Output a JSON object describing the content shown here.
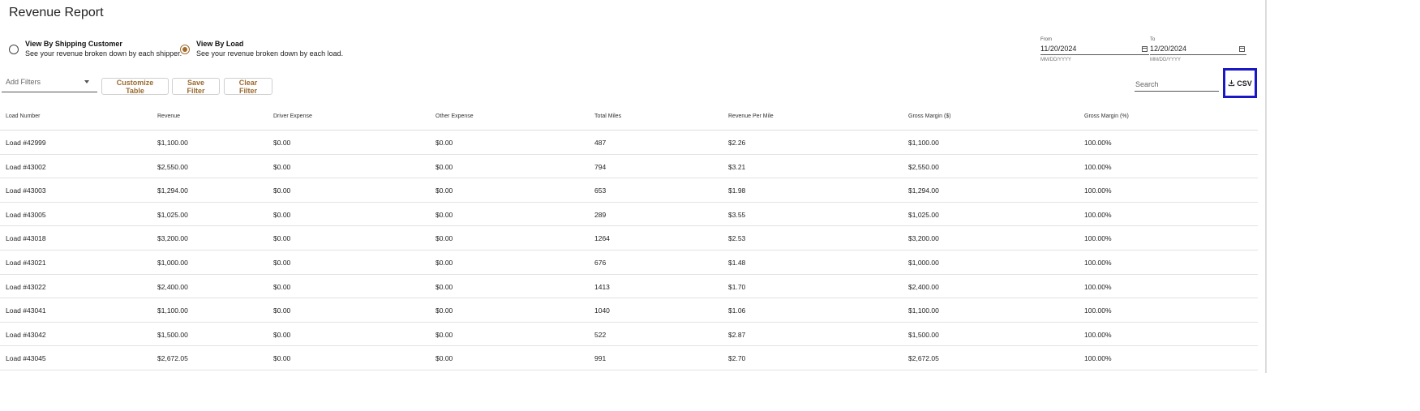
{
  "page": {
    "title": "Revenue Report"
  },
  "view_options": [
    {
      "label": "View By Shipping Customer",
      "description": "See your revenue broken down by each shipper.",
      "selected": false
    },
    {
      "label": "View By Load",
      "description": "See your revenue broken down by each load.",
      "selected": true
    }
  ],
  "date_from": {
    "label": "From",
    "value": "11/20/2024",
    "hint": "MM/DD/YYYY",
    "icon": "calendar-icon"
  },
  "date_to": {
    "label": "To",
    "value": "12/20/2024",
    "hint": "MM/DD/YYYY",
    "icon": "calendar-icon"
  },
  "filters": {
    "add_filters_placeholder": "Add Filters",
    "customize_table": "Customize Table",
    "save_filter": "Save Filter",
    "clear_filter": "Clear Filter",
    "search_placeholder": "Search",
    "csv_label": "CSV",
    "csv_icon": "download-icon"
  },
  "colors": {
    "accent": "#a36b2a",
    "button_text": "#9a6a2f",
    "highlight_border": "#1a17c4"
  },
  "table": {
    "columns": [
      "Load Number",
      "Revenue",
      "Driver Expense",
      "Other Expense",
      "Total Miles",
      "Revenue Per Mile",
      "Gross Margin ($)",
      "Gross Margin (%)"
    ],
    "rows": [
      [
        "Load #42999",
        "$1,100.00",
        "$0.00",
        "$0.00",
        "487",
        "$2.26",
        "$1,100.00",
        "100.00%"
      ],
      [
        "Load #43002",
        "$2,550.00",
        "$0.00",
        "$0.00",
        "794",
        "$3.21",
        "$2,550.00",
        "100.00%"
      ],
      [
        "Load #43003",
        "$1,294.00",
        "$0.00",
        "$0.00",
        "653",
        "$1.98",
        "$1,294.00",
        "100.00%"
      ],
      [
        "Load #43005",
        "$1,025.00",
        "$0.00",
        "$0.00",
        "289",
        "$3.55",
        "$1,025.00",
        "100.00%"
      ],
      [
        "Load #43018",
        "$3,200.00",
        "$0.00",
        "$0.00",
        "1264",
        "$2.53",
        "$3,200.00",
        "100.00%"
      ],
      [
        "Load #43021",
        "$1,000.00",
        "$0.00",
        "$0.00",
        "676",
        "$1.48",
        "$1,000.00",
        "100.00%"
      ],
      [
        "Load #43022",
        "$2,400.00",
        "$0.00",
        "$0.00",
        "1413",
        "$1.70",
        "$2,400.00",
        "100.00%"
      ],
      [
        "Load #43041",
        "$1,100.00",
        "$0.00",
        "$0.00",
        "1040",
        "$1.06",
        "$1,100.00",
        "100.00%"
      ],
      [
        "Load #43042",
        "$1,500.00",
        "$0.00",
        "$0.00",
        "522",
        "$2.87",
        "$1,500.00",
        "100.00%"
      ],
      [
        "Load #43045",
        "$2,672.05",
        "$0.00",
        "$0.00",
        "991",
        "$2.70",
        "$2,672.05",
        "100.00%"
      ]
    ]
  }
}
